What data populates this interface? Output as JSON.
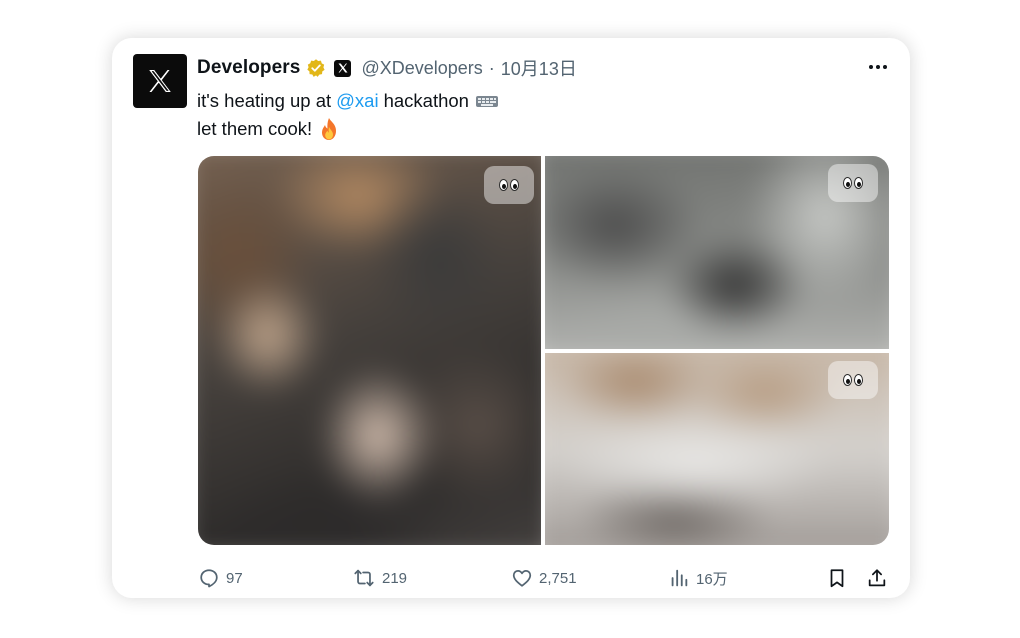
{
  "tweet": {
    "author_name": "Developers",
    "handle": "@XDevelopers",
    "separator": "·",
    "date": "10月13日",
    "text_line1_before": "it's heating up at",
    "mention": "@xai",
    "text_line1_after": "hackathon",
    "text_line2": "let them cook!",
    "more_icon": "more-dots-icon",
    "verified_color": "#e2b719",
    "link_color": "#1d9bf0"
  },
  "media": {
    "alt_badge_icon": "eyes-emoji-icon",
    "count": 3
  },
  "actions": {
    "replies": "97",
    "reposts": "219",
    "likes": "2,751",
    "views": "16万"
  }
}
